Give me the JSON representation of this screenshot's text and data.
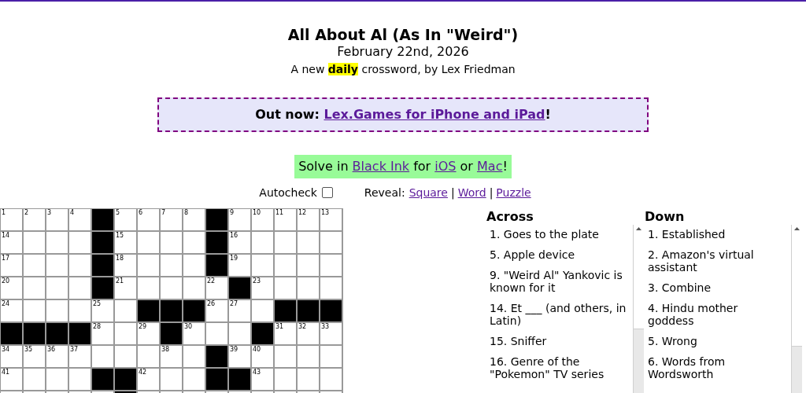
{
  "title": "All About Al (As In \"Weird\")",
  "date": "February 22nd, 2026",
  "subtitle": "A new **daily** crossword, by Lex Friedman",
  "banner": {
    "prefix": "Out now: ",
    "link": "Lex.Games for iPhone and iPad",
    "suffix": "!"
  },
  "solve_in": [
    {
      "kind": "text",
      "text": "Solve in "
    },
    {
      "kind": "link",
      "text": "Black Ink"
    },
    {
      "kind": "text",
      "text": " for "
    },
    {
      "kind": "link",
      "text": "iOS"
    },
    {
      "kind": "text",
      "text": " or "
    },
    {
      "kind": "link",
      "text": "Mac"
    },
    {
      "kind": "text",
      "text": "!"
    }
  ],
  "autocheck": {
    "label": "Autocheck",
    "checked": false
  },
  "reveal": {
    "label": "Reveal:",
    "links": [
      "Square",
      "Word",
      "Puzzle"
    ],
    "separator": "|"
  },
  "grid": [
    [
      {
        "kind": "white",
        "number": "1"
      },
      {
        "kind": "white",
        "number": "2"
      },
      {
        "kind": "white",
        "number": "3"
      },
      {
        "kind": "white",
        "number": "4"
      },
      {
        "kind": "black"
      },
      {
        "kind": "white",
        "number": "5"
      },
      {
        "kind": "white",
        "number": "6"
      },
      {
        "kind": "white",
        "number": "7"
      },
      {
        "kind": "white",
        "number": "8"
      },
      {
        "kind": "black"
      },
      {
        "kind": "white",
        "number": "9"
      },
      {
        "kind": "white",
        "number": "10"
      },
      {
        "kind": "white",
        "number": "11"
      },
      {
        "kind": "white",
        "number": "12"
      },
      {
        "kind": "white",
        "number": "13"
      }
    ],
    [
      {
        "kind": "white",
        "number": "14"
      },
      {
        "kind": "white"
      },
      {
        "kind": "white"
      },
      {
        "kind": "white"
      },
      {
        "kind": "black"
      },
      {
        "kind": "white",
        "number": "15"
      },
      {
        "kind": "white"
      },
      {
        "kind": "white"
      },
      {
        "kind": "white"
      },
      {
        "kind": "black"
      },
      {
        "kind": "white",
        "number": "16"
      },
      {
        "kind": "white"
      },
      {
        "kind": "white"
      },
      {
        "kind": "white"
      },
      {
        "kind": "white"
      }
    ],
    [
      {
        "kind": "white",
        "number": "17"
      },
      {
        "kind": "white"
      },
      {
        "kind": "white"
      },
      {
        "kind": "white"
      },
      {
        "kind": "black"
      },
      {
        "kind": "white",
        "number": "18"
      },
      {
        "kind": "white"
      },
      {
        "kind": "white"
      },
      {
        "kind": "white"
      },
      {
        "kind": "black"
      },
      {
        "kind": "white",
        "number": "19"
      },
      {
        "kind": "white"
      },
      {
        "kind": "white"
      },
      {
        "kind": "white"
      },
      {
        "kind": "white"
      }
    ],
    [
      {
        "kind": "white",
        "number": "20"
      },
      {
        "kind": "white"
      },
      {
        "kind": "white"
      },
      {
        "kind": "white"
      },
      {
        "kind": "black"
      },
      {
        "kind": "white",
        "number": "21"
      },
      {
        "kind": "white"
      },
      {
        "kind": "white"
      },
      {
        "kind": "white"
      },
      {
        "kind": "white",
        "number": "22"
      },
      {
        "kind": "black"
      },
      {
        "kind": "white",
        "number": "23"
      },
      {
        "kind": "white"
      },
      {
        "kind": "white"
      },
      {
        "kind": "white"
      }
    ],
    [
      {
        "kind": "white",
        "number": "24"
      },
      {
        "kind": "white"
      },
      {
        "kind": "white"
      },
      {
        "kind": "white"
      },
      {
        "kind": "white",
        "number": "25"
      },
      {
        "kind": "white"
      },
      {
        "kind": "black"
      },
      {
        "kind": "black"
      },
      {
        "kind": "black"
      },
      {
        "kind": "white",
        "number": "26"
      },
      {
        "kind": "white",
        "number": "27"
      },
      {
        "kind": "white"
      },
      {
        "kind": "black"
      },
      {
        "kind": "black"
      },
      {
        "kind": "black"
      }
    ],
    [
      {
        "kind": "black"
      },
      {
        "kind": "black"
      },
      {
        "kind": "black"
      },
      {
        "kind": "black"
      },
      {
        "kind": "white",
        "number": "28"
      },
      {
        "kind": "white"
      },
      {
        "kind": "white",
        "number": "29"
      },
      {
        "kind": "black"
      },
      {
        "kind": "white",
        "number": "30"
      },
      {
        "kind": "white"
      },
      {
        "kind": "white"
      },
      {
        "kind": "black"
      },
      {
        "kind": "white",
        "number": "31"
      },
      {
        "kind": "white",
        "number": "32"
      },
      {
        "kind": "white",
        "number": "33"
      }
    ],
    [
      {
        "kind": "white",
        "number": "34"
      },
      {
        "kind": "white",
        "number": "35"
      },
      {
        "kind": "white",
        "number": "36"
      },
      {
        "kind": "white",
        "number": "37"
      },
      {
        "kind": "white"
      },
      {
        "kind": "white"
      },
      {
        "kind": "white"
      },
      {
        "kind": "white",
        "number": "38"
      },
      {
        "kind": "white"
      },
      {
        "kind": "black"
      },
      {
        "kind": "white",
        "number": "39"
      },
      {
        "kind": "white",
        "number": "40"
      },
      {
        "kind": "white"
      },
      {
        "kind": "white"
      },
      {
        "kind": "white"
      }
    ],
    [
      {
        "kind": "white",
        "number": "41"
      },
      {
        "kind": "white"
      },
      {
        "kind": "white"
      },
      {
        "kind": "white"
      },
      {
        "kind": "black"
      },
      {
        "kind": "black"
      },
      {
        "kind": "white",
        "number": "42"
      },
      {
        "kind": "white"
      },
      {
        "kind": "white"
      },
      {
        "kind": "black"
      },
      {
        "kind": "black"
      },
      {
        "kind": "white",
        "number": "43"
      },
      {
        "kind": "white"
      },
      {
        "kind": "white"
      },
      {
        "kind": "white"
      }
    ],
    [
      {
        "kind": "white"
      },
      {
        "kind": "white"
      },
      {
        "kind": "white"
      },
      {
        "kind": "white"
      },
      {
        "kind": "white"
      },
      {
        "kind": "black"
      },
      {
        "kind": "white"
      },
      {
        "kind": "white"
      },
      {
        "kind": "white"
      },
      {
        "kind": "white"
      },
      {
        "kind": "white"
      },
      {
        "kind": "white"
      },
      {
        "kind": "white"
      },
      {
        "kind": "white"
      },
      {
        "kind": "white"
      }
    ]
  ],
  "across": {
    "heading": "Across",
    "clues": [
      "1. Goes to the plate",
      "5. Apple device",
      "9. \"Weird Al\" Yankovic is known for it",
      "14. Et ___ (and others, in Latin)",
      "15. Sniffer",
      "16. Genre of the \"Pokemon\" TV series"
    ]
  },
  "down": {
    "heading": "Down",
    "clues": [
      "1. Established",
      "2. Amazon's virtual assistant",
      "3. Combine",
      "4. Hindu mother goddess",
      "5. Wrong",
      "6. Words from Wordsworth"
    ]
  }
}
